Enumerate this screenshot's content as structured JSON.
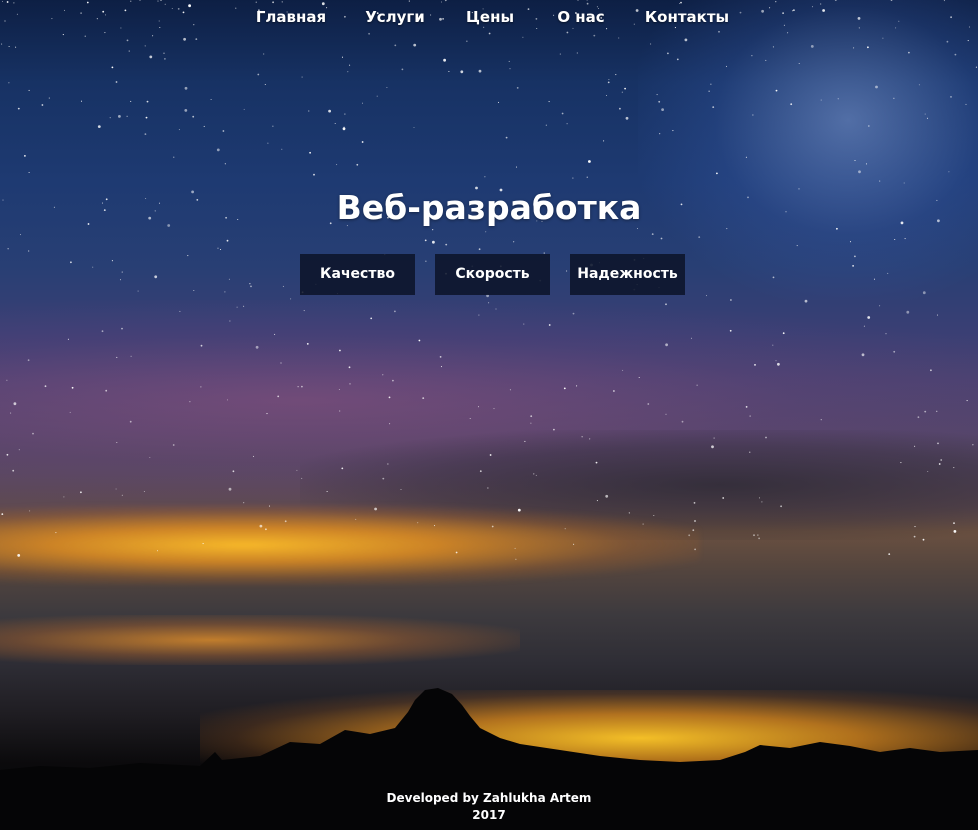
{
  "nav": {
    "items": [
      {
        "label": "Главная"
      },
      {
        "label": "Услуги"
      },
      {
        "label": "Цены"
      },
      {
        "label": "О нас"
      },
      {
        "label": "Контакты"
      }
    ]
  },
  "hero": {
    "title": "Веб-разработка",
    "buttons": [
      {
        "label": "Качество"
      },
      {
        "label": "Скорость"
      },
      {
        "label": "Надежность"
      }
    ]
  },
  "footer": {
    "credit": "Developed by Zahlukha Artem",
    "year": "2017"
  },
  "colors": {
    "text": "#ffffff",
    "button_bg": "#0c142a",
    "sky_top": "#0d1f44",
    "horizon_glow": "#ffbe28"
  }
}
